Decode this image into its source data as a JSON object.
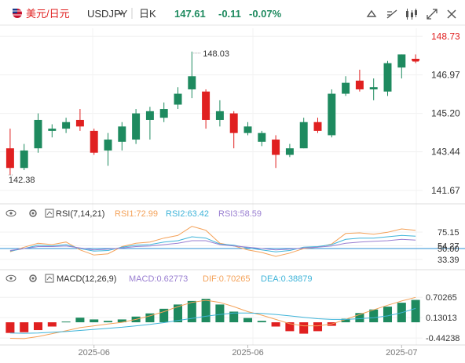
{
  "header": {
    "pair": "美元/日元",
    "symbol": "USDJPY",
    "timeframe": "日K",
    "last": "147.61",
    "change": "-0.11",
    "change_pct": "-0.07%"
  },
  "colors": {
    "up": "#1e8a5f",
    "down": "#e02020",
    "rsi1": "#f4a259",
    "rsi2": "#3fb4d9",
    "rsi3": "#9a7fd1",
    "dif": "#f4a259",
    "dea": "#3fb4d9",
    "red_text": "#e02020",
    "green_text": "#1e8a5f"
  },
  "icons": [
    "flag-icon",
    "dropdown-icon",
    "flag-icon",
    "fullscreen-icon",
    "indicator-icon",
    "draw-icon",
    "candle-type-icon",
    "expand-icon",
    "close-icon",
    "gear-icon",
    "eye-icon"
  ],
  "chart_data": [
    {
      "type": "candlestick",
      "title": "USDJPY 日K",
      "y_ticks": [
        "148.73",
        "146.97",
        "145.20",
        "143.44",
        "141.67"
      ],
      "ylim": [
        141.2,
        149.1
      ],
      "max_label": "148.03",
      "min_label": "142.38",
      "x_ticks": [
        "2025-06",
        "2025-06",
        "2025-07"
      ],
      "candles": [
        {
          "o": 143.6,
          "h": 144.5,
          "l": 142.38,
          "c": 142.7
        },
        {
          "o": 142.7,
          "h": 143.8,
          "l": 142.6,
          "c": 143.5
        },
        {
          "o": 143.6,
          "h": 145.2,
          "l": 143.4,
          "c": 144.9
        },
        {
          "o": 144.4,
          "h": 144.7,
          "l": 144.1,
          "c": 144.5
        },
        {
          "o": 144.5,
          "h": 145.0,
          "l": 144.3,
          "c": 144.8
        },
        {
          "o": 144.9,
          "h": 145.4,
          "l": 144.4,
          "c": 144.6
        },
        {
          "o": 144.4,
          "h": 144.5,
          "l": 143.3,
          "c": 143.4
        },
        {
          "o": 143.5,
          "h": 144.3,
          "l": 142.8,
          "c": 144.0
        },
        {
          "o": 143.9,
          "h": 144.8,
          "l": 143.5,
          "c": 144.6
        },
        {
          "o": 144.0,
          "h": 145.4,
          "l": 143.8,
          "c": 145.2
        },
        {
          "o": 144.9,
          "h": 145.5,
          "l": 144.0,
          "c": 145.3
        },
        {
          "o": 145.0,
          "h": 145.7,
          "l": 144.8,
          "c": 145.4
        },
        {
          "o": 145.6,
          "h": 146.4,
          "l": 145.4,
          "c": 146.1
        },
        {
          "o": 146.3,
          "h": 148.03,
          "l": 145.9,
          "c": 146.9
        },
        {
          "o": 146.2,
          "h": 146.3,
          "l": 144.5,
          "c": 144.9
        },
        {
          "o": 144.9,
          "h": 145.8,
          "l": 144.6,
          "c": 145.3
        },
        {
          "o": 145.2,
          "h": 145.3,
          "l": 143.6,
          "c": 144.3
        },
        {
          "o": 144.3,
          "h": 144.8,
          "l": 144.2,
          "c": 144.6
        },
        {
          "o": 143.9,
          "h": 144.4,
          "l": 143.7,
          "c": 144.3
        },
        {
          "o": 144.0,
          "h": 144.2,
          "l": 142.7,
          "c": 143.3
        },
        {
          "o": 143.3,
          "h": 143.8,
          "l": 143.2,
          "c": 143.6
        },
        {
          "o": 143.6,
          "h": 145.0,
          "l": 143.6,
          "c": 144.8
        },
        {
          "o": 144.8,
          "h": 145.0,
          "l": 144.3,
          "c": 144.4
        },
        {
          "o": 144.2,
          "h": 146.3,
          "l": 144.1,
          "c": 146.1
        },
        {
          "o": 146.1,
          "h": 146.9,
          "l": 146.0,
          "c": 146.6
        },
        {
          "o": 146.7,
          "h": 147.2,
          "l": 146.2,
          "c": 146.3
        },
        {
          "o": 146.3,
          "h": 146.8,
          "l": 145.8,
          "c": 146.4
        },
        {
          "o": 146.2,
          "h": 147.6,
          "l": 146.0,
          "c": 147.5
        },
        {
          "o": 147.3,
          "h": 147.9,
          "l": 146.8,
          "c": 147.9
        },
        {
          "o": 147.7,
          "h": 147.9,
          "l": 147.5,
          "c": 147.61
        }
      ]
    },
    {
      "type": "line",
      "title": "RSI(7,14,21)",
      "labels": {
        "rsi1": "RSI1:72.99",
        "rsi2": "RSI2:63.42",
        "rsi3": "RSI3:58.59"
      },
      "y_ticks": [
        "75.15",
        "54.27",
        "50.00",
        "33.39"
      ],
      "ylim": [
        20,
        92
      ],
      "series": [
        {
          "name": "RSI1",
          "values": [
            45,
            52,
            58,
            56,
            60,
            48,
            40,
            42,
            53,
            58,
            60,
            66,
            70,
            84,
            78,
            58,
            54,
            48,
            44,
            38,
            43,
            50,
            52,
            57,
            73,
            74,
            72,
            75,
            80,
            78
          ]
        },
        {
          "name": "RSI2",
          "values": [
            46,
            50,
            55,
            54,
            56,
            50,
            46,
            47,
            52,
            55,
            56,
            60,
            62,
            68,
            66,
            57,
            55,
            51,
            48,
            45,
            47,
            52,
            53,
            56,
            64,
            66,
            66,
            68,
            70,
            69
          ]
        },
        {
          "name": "RSI3",
          "values": [
            47,
            50,
            53,
            53,
            54,
            51,
            48,
            49,
            51,
            53,
            54,
            56,
            58,
            62,
            62,
            56,
            54,
            52,
            50,
            48,
            49,
            51,
            52,
            54,
            58,
            60,
            61,
            62,
            64,
            63
          ]
        }
      ]
    },
    {
      "type": "bar",
      "title": "MACD(12,26,9)",
      "labels": {
        "macd": "MACD:0.62773",
        "dif": "DIF:0.70265",
        "dea": "DEA:0.38879"
      },
      "y_ticks": [
        "0.70265",
        "0.13013",
        "-0.44238"
      ],
      "ylim": [
        -0.55,
        0.95
      ],
      "series": [
        {
          "name": "MACD",
          "values": [
            -0.3,
            -0.28,
            -0.22,
            -0.12,
            0.02,
            0.13,
            0.08,
            0.04,
            0.08,
            0.16,
            0.25,
            0.38,
            0.5,
            0.6,
            0.66,
            0.5,
            0.3,
            0.12,
            0.04,
            -0.12,
            -0.25,
            -0.32,
            -0.25,
            -0.1,
            0.1,
            0.26,
            0.36,
            0.44,
            0.55,
            0.63
          ]
        },
        {
          "name": "DIF",
          "values": [
            -0.45,
            -0.46,
            -0.4,
            -0.32,
            -0.24,
            -0.15,
            -0.1,
            -0.05,
            0.0,
            0.08,
            0.18,
            0.3,
            0.44,
            0.56,
            0.62,
            0.56,
            0.44,
            0.3,
            0.2,
            0.08,
            -0.04,
            -0.1,
            -0.1,
            -0.05,
            0.08,
            0.22,
            0.35,
            0.48,
            0.6,
            0.7
          ]
        },
        {
          "name": "DEA",
          "values": [
            -0.3,
            -0.31,
            -0.3,
            -0.28,
            -0.26,
            -0.23,
            -0.2,
            -0.17,
            -0.14,
            -0.1,
            -0.06,
            -0.01,
            0.05,
            0.11,
            0.17,
            0.22,
            0.26,
            0.26,
            0.25,
            0.22,
            0.18,
            0.14,
            0.1,
            0.08,
            0.08,
            0.1,
            0.13,
            0.18,
            0.27,
            0.39
          ]
        }
      ]
    }
  ]
}
